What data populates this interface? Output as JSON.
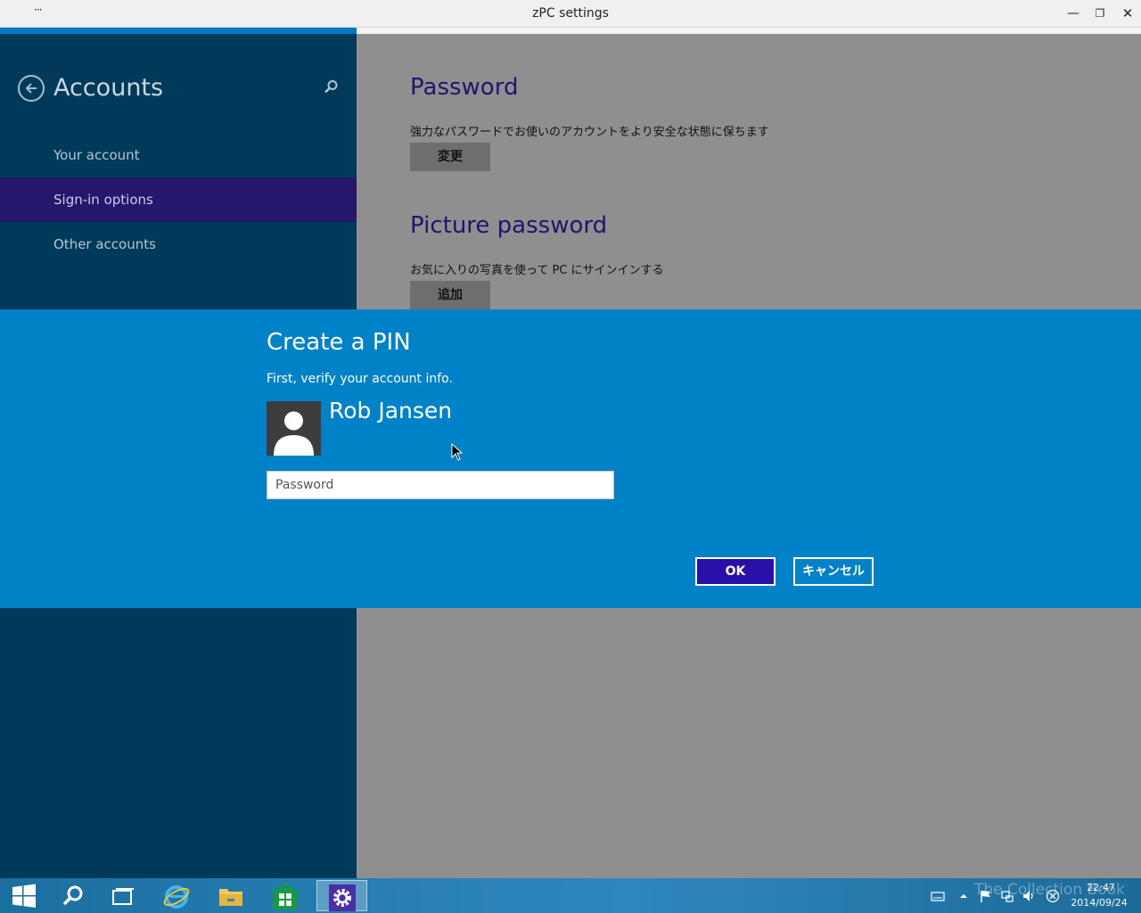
{
  "window": {
    "title": "zPC settings",
    "menu_label": "···",
    "minimize_label": "—",
    "restore_label": "❐",
    "close_label": "✕"
  },
  "sidebar": {
    "title": "Accounts",
    "items": [
      {
        "label": "Your account",
        "active": false
      },
      {
        "label": "Sign-in options",
        "active": true
      },
      {
        "label": "Other accounts",
        "active": false
      }
    ]
  },
  "main": {
    "password": {
      "title": "Password",
      "description": "強力なパスワードでお使いのアカウントをより安全な状態に保ちます",
      "button_label": "変更"
    },
    "picture_password": {
      "title": "Picture password",
      "description": "お気に入りの写真を使って PC にサインインする",
      "button_label": "追加"
    }
  },
  "dialog": {
    "title": "Create a PIN",
    "subtitle": "First, verify your account info.",
    "user_name": "Rob Jansen",
    "password_placeholder": "Password",
    "password_value": "",
    "ok_label": "OK",
    "cancel_label": "キャンセル"
  },
  "taskbar": {
    "items": [
      "start-icon",
      "search-icon",
      "task-view-icon",
      "internet-explorer-icon",
      "file-explorer-icon",
      "store-icon",
      "settings-icon"
    ],
    "active_item": "settings-icon",
    "tray_icons": [
      "keyboard-icon",
      "chevron-up-icon",
      "flag-icon",
      "network-icon",
      "volume-icon",
      "close-circle-icon"
    ],
    "watermark": "The Collection Book",
    "clock_time": "22:47",
    "clock_date": "2014/09/24"
  },
  "colors": {
    "left_pane": "#003a5a",
    "active_nav": "#25176b",
    "dialog": "#0082c9",
    "ok_button": "#2a0fa8",
    "section_title": "#22146e"
  }
}
